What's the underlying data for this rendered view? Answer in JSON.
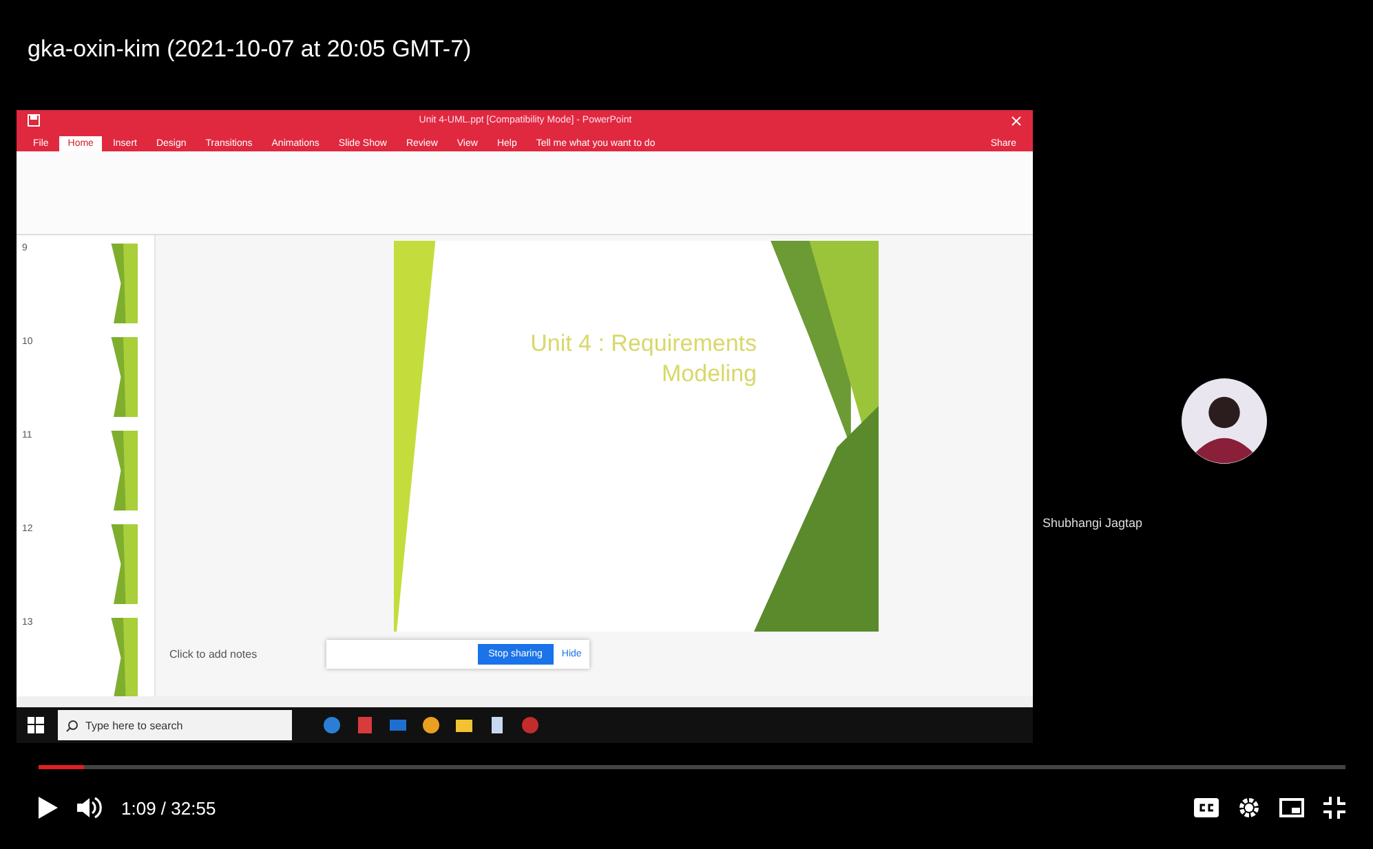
{
  "video_title": "gka-oxin-kim (2021-10-07 at 20:05 GMT-7)",
  "powerpoint": {
    "window_title": "Unit 4-UML.ppt [Compatibility Mode] - PowerPoint",
    "tabs": [
      {
        "label": "File",
        "selected": false
      },
      {
        "label": "Home",
        "selected": true
      },
      {
        "label": "Insert",
        "selected": false
      },
      {
        "label": "Design",
        "selected": false
      },
      {
        "label": "Transitions",
        "selected": false
      },
      {
        "label": "Animations",
        "selected": false
      },
      {
        "label": "Slide Show",
        "selected": false
      },
      {
        "label": "Review",
        "selected": false
      },
      {
        "label": "View",
        "selected": false
      },
      {
        "label": "Help",
        "selected": false
      }
    ],
    "tell_me": "Tell me what you want to do",
    "share": "Share",
    "thumbnails": [
      {
        "number": "9"
      },
      {
        "number": "10"
      },
      {
        "number": "11"
      },
      {
        "number": "12"
      },
      {
        "number": "13"
      }
    ],
    "slide_title": "Unit 4 : Requirements Modeling",
    "notes_placeholder": "Click to add notes",
    "stop_sharing": "Stop sharing",
    "hide": "Hide"
  },
  "taskbar": {
    "search_placeholder": "Type here to search"
  },
  "participant": {
    "name": "Shubhangi Jagtap"
  },
  "player": {
    "level": 0.035,
    "time": "1:09 / 32:55"
  }
}
